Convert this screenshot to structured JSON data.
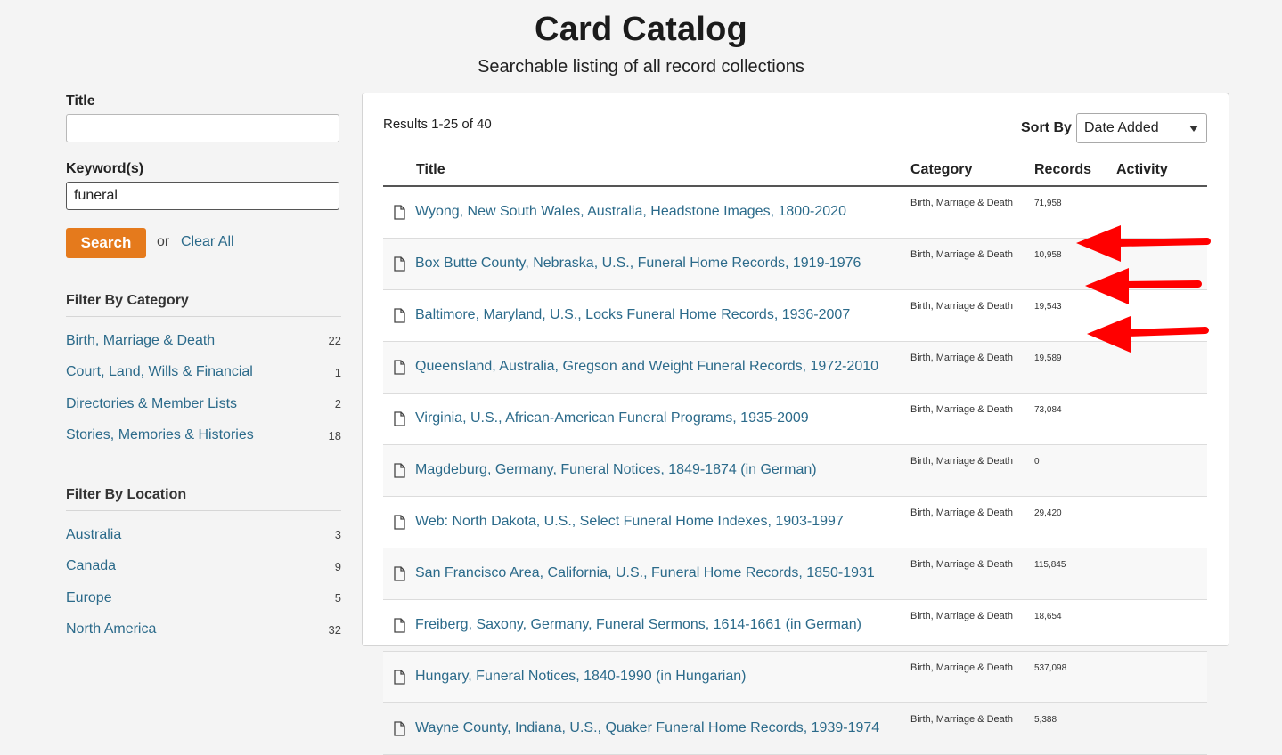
{
  "header": {
    "title": "Card Catalog",
    "subtitle": "Searchable listing of all record collections"
  },
  "sidebar": {
    "title_label": "Title",
    "title_value": "",
    "keyword_label": "Keyword(s)",
    "keyword_value": "funeral",
    "search_label": "Search",
    "or_text": "or",
    "clear_label": "Clear All",
    "category_filter": {
      "heading": "Filter By Category",
      "items": [
        {
          "label": "Birth, Marriage & Death",
          "count": "22"
        },
        {
          "label": "Court, Land, Wills & Financial",
          "count": "1"
        },
        {
          "label": "Directories & Member Lists",
          "count": "2"
        },
        {
          "label": "Stories, Memories & Histories",
          "count": "18"
        }
      ]
    },
    "location_filter": {
      "heading": "Filter By Location",
      "items": [
        {
          "label": "Australia",
          "count": "3"
        },
        {
          "label": "Canada",
          "count": "9"
        },
        {
          "label": "Europe",
          "count": "5"
        },
        {
          "label": "North America",
          "count": "32"
        }
      ]
    }
  },
  "results": {
    "count_text": "Results 1-25 of 40",
    "sort_label": "Sort By",
    "sort_value": "Date Added",
    "columns": {
      "title": "Title",
      "category": "Category",
      "records": "Records",
      "activity": "Activity"
    },
    "rows": [
      {
        "title": "Wyong, New South Wales, Australia, Headstone Images, 1800-2020",
        "category": "Birth, Marriage & Death",
        "records": "71,958"
      },
      {
        "title": "Box Butte County, Nebraska, U.S., Funeral Home Records, 1919-1976",
        "category": "Birth, Marriage & Death",
        "records": "10,958"
      },
      {
        "title": "Baltimore, Maryland, U.S., Locks Funeral Home Records, 1936-2007",
        "category": "Birth, Marriage & Death",
        "records": "19,543"
      },
      {
        "title": "Queensland, Australia, Gregson and Weight Funeral Records, 1972-2010",
        "category": "Birth, Marriage & Death",
        "records": "19,589"
      },
      {
        "title": "Virginia, U.S., African-American Funeral Programs, 1935-2009",
        "category": "Birth, Marriage & Death",
        "records": "73,084"
      },
      {
        "title": "Magdeburg, Germany, Funeral Notices, 1849-1874 (in German)",
        "category": "Birth, Marriage & Death",
        "records": "0"
      },
      {
        "title": "Web: North Dakota, U.S., Select Funeral Home Indexes, 1903-1997",
        "category": "Birth, Marriage & Death",
        "records": "29,420"
      },
      {
        "title": "San Francisco Area, California, U.S., Funeral Home Records, 1850-1931",
        "category": "Birth, Marriage & Death",
        "records": "115,845"
      },
      {
        "title": "Freiberg, Saxony, Germany, Funeral Sermons, 1614-1661 (in German)",
        "category": "Birth, Marriage & Death",
        "records": "18,654"
      },
      {
        "title": "Hungary, Funeral Notices, 1840-1990 (in Hungarian)",
        "category": "Birth, Marriage & Death",
        "records": "537,098"
      },
      {
        "title": "Wayne County, Indiana, U.S., Quaker Funeral Home Records, 1939-1974",
        "category": "Birth, Marriage & Death",
        "records": "5,388"
      }
    ]
  },
  "colors": {
    "accent": "#e57a1c",
    "link": "#2b6a8a",
    "arrow": "#ff0000"
  },
  "icons": {
    "row_icon": "document-icon",
    "annotation": "red-arrow-icon"
  }
}
